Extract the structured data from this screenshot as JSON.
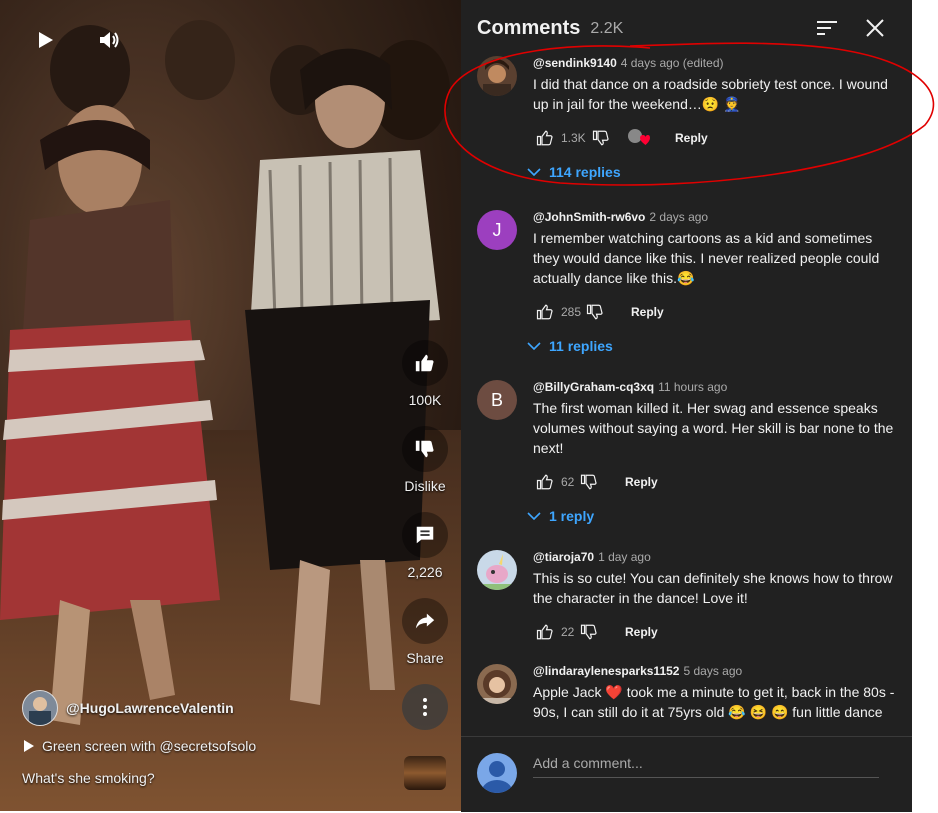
{
  "short": {
    "channel": "@HugoLawrenceValentin",
    "music": "Green screen with @secretsofsolo",
    "caption": "What's she smoking?",
    "actions": {
      "likes": "100K",
      "dislike": "Dislike",
      "comments": "2,226",
      "share": "Share"
    }
  },
  "comments_panel": {
    "title": "Comments",
    "count": "2.2K",
    "add_placeholder": "Add a comment...",
    "comments": [
      {
        "user": "@sendink9140",
        "time": "4 days ago (edited)",
        "text": "I did that dance on a roadside sobriety test once. I wound up in jail for the weekend…😟 👮",
        "likes": "1.3K",
        "reply_label": "Reply",
        "replies": "114 replies",
        "avatar_letter": "",
        "avatar_color": "#5a4030"
      },
      {
        "user": "@JohnSmith-rw6vo",
        "time": "2 days ago",
        "text": "I remember watching cartoons as a kid and sometimes they would dance like this. I never realized people could actually dance like this.😂",
        "likes": "285",
        "reply_label": "Reply",
        "replies": "11 replies",
        "avatar_letter": "J",
        "avatar_color": "#9c3fbf"
      },
      {
        "user": "@BillyGraham-cq3xq",
        "time": "11 hours ago",
        "text": "The first woman killed it. Her swag and essence speaks volumes without saying a word. Her skill is bar none to the next!",
        "likes": "62",
        "reply_label": "Reply",
        "replies": "1 reply",
        "avatar_letter": "B",
        "avatar_color": "#6d4c41"
      },
      {
        "user": "@tiaroja70",
        "time": "1 day ago",
        "text": "This is so cute! You can definitely she knows how to throw the character in the dance! Love it!",
        "likes": "22",
        "reply_label": "Reply",
        "avatar_letter": "",
        "avatar_color": "#c9d9e8"
      },
      {
        "user": "@lindaraylenesparks1152",
        "time": "5 days ago",
        "text": "Apple Jack ❤️ took me a minute to get it, back in the 80s - 90s, I can still do it at 75yrs old 😂 😆 😄 fun little dance",
        "avatar_letter": "",
        "avatar_color": "#8a6a50"
      }
    ]
  },
  "colors": {
    "panel_bg": "#212121",
    "link_blue": "#3ea6ff",
    "annotation_red": "#e00000",
    "heart_red": "#ff0033"
  }
}
